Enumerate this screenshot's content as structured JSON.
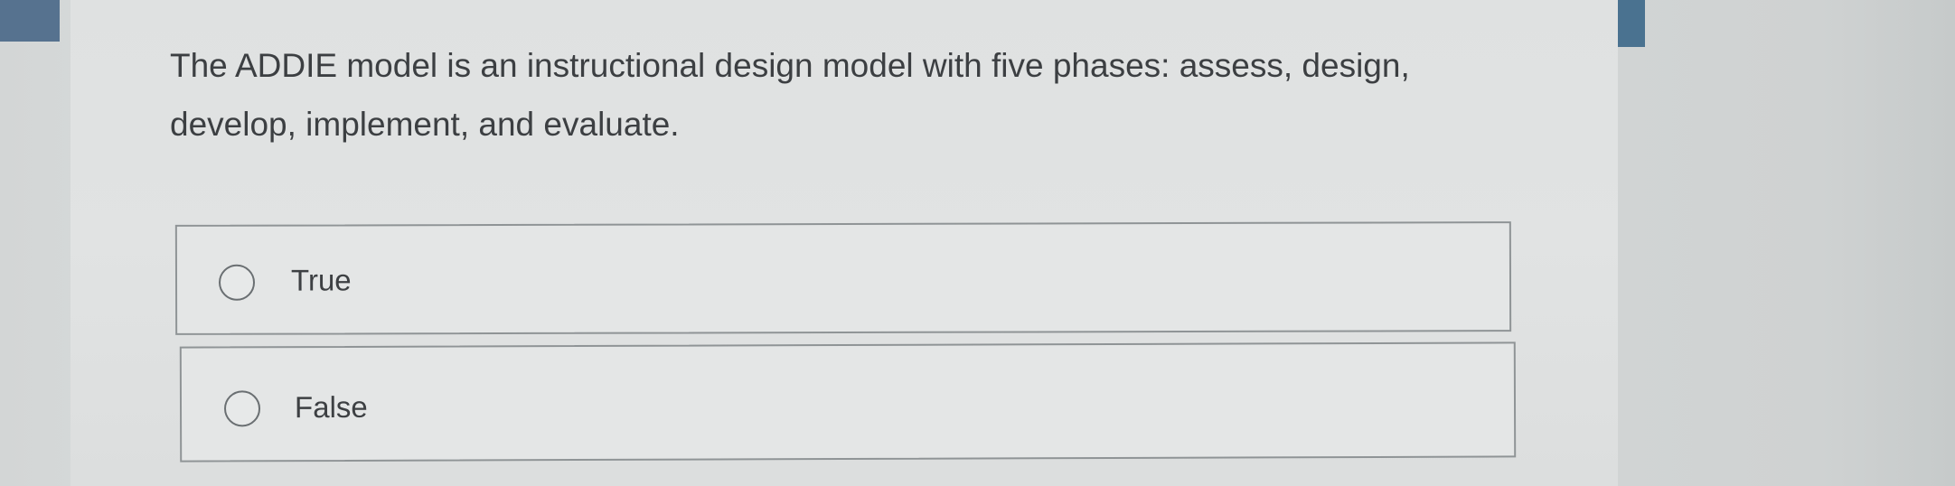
{
  "question": {
    "text": "The ADDIE model is an instructional design model with five phases: assess, design, develop, implement, and evaluate."
  },
  "options": [
    {
      "label": "True",
      "selected": false
    },
    {
      "label": "False",
      "selected": false
    }
  ],
  "colors": {
    "accent_tab": "#56728f",
    "right_tab": "#4a7290",
    "text": "#3c3f42",
    "border": "#8f9496"
  },
  "icons": {
    "radio": "radio-unchecked-icon"
  }
}
